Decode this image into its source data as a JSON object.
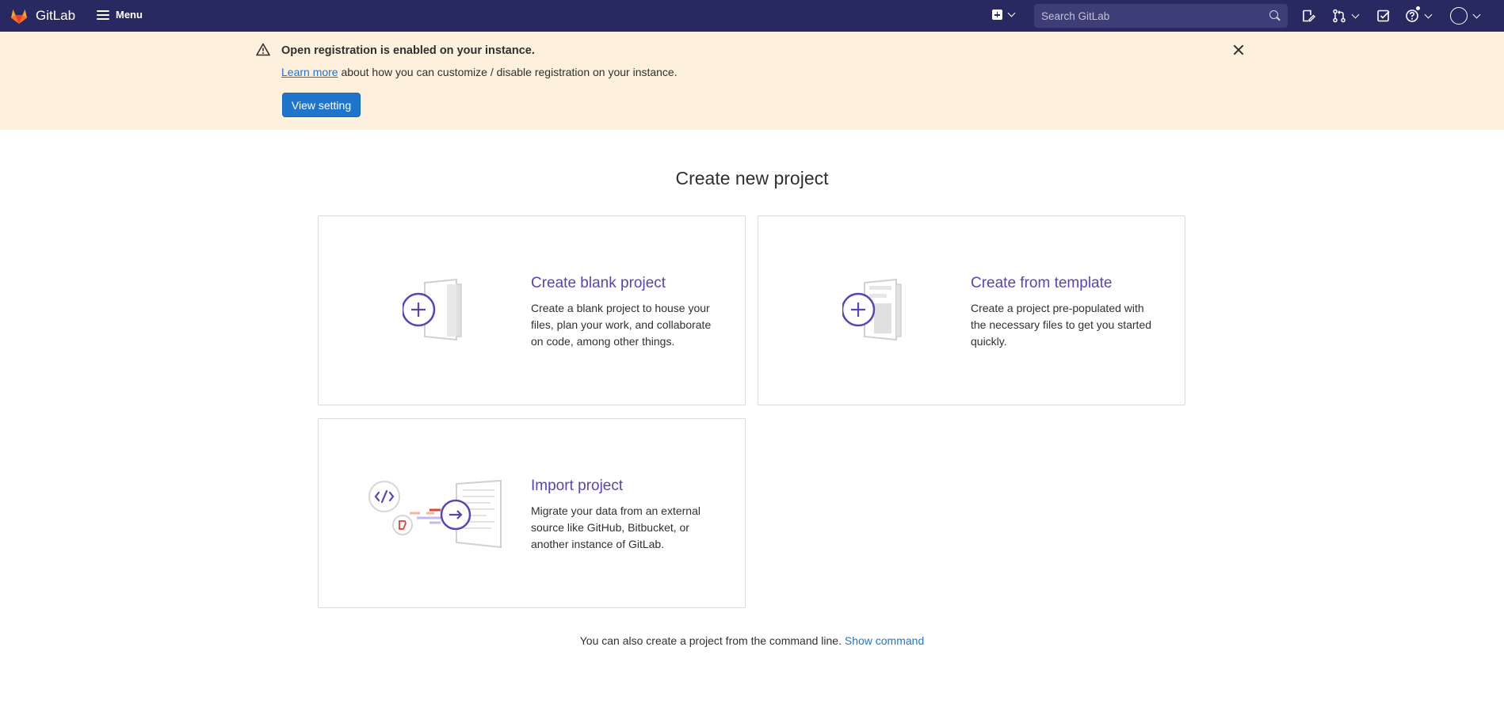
{
  "navbar": {
    "logo_text": "GitLab",
    "menu_label": "Menu",
    "search_placeholder": "Search GitLab",
    "colors": {
      "background": "#292961",
      "search_bg": "#3d3d77"
    },
    "icons": [
      "gitlab-logo-icon",
      "hamburger-icon",
      "plus-square-icon",
      "search-icon",
      "issues-icon",
      "merge-request-icon",
      "todo-icon",
      "help-icon",
      "avatar-icon"
    ]
  },
  "banner": {
    "title": "Open registration is enabled on your instance.",
    "link_text": "Learn more",
    "body_text": " about how you can customize / disable registration on your instance.",
    "button_label": "View setting",
    "colors": {
      "background": "#fdf1dd",
      "button": "#1f75cb"
    }
  },
  "main": {
    "title": "Create new project",
    "cards": [
      {
        "title": "Create blank project",
        "description": "Create a blank project to house your files, plan your work, and collaborate on code, among other things."
      },
      {
        "title": "Create from template",
        "description": "Create a project pre-populated with the necessary files to get you started quickly."
      },
      {
        "title": "Import project",
        "description": "Migrate your data from an external source like GitHub, Bitbucket, or another instance of GitLab."
      }
    ],
    "footer_text": "You can also create a project from the command line. ",
    "footer_link": "Show command",
    "colors": {
      "accent": "#5943b6",
      "link": "#1f75cb"
    }
  }
}
